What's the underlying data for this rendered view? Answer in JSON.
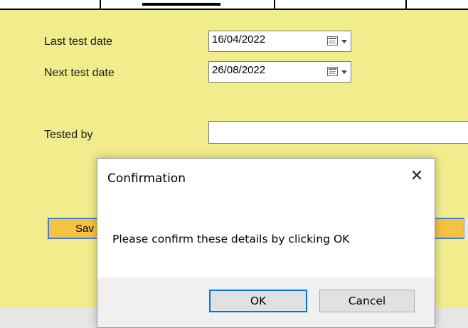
{
  "form": {
    "last_test_date_label": "Last test date",
    "last_test_date_value": "16/04/2022",
    "next_test_date_label": "Next test date",
    "next_test_date_value": "26/08/2022",
    "tested_by_label": "Tested by",
    "tested_by_value": "",
    "save_button_label": "Sav"
  },
  "dialog": {
    "title": "Confirmation",
    "close_glyph": "✕",
    "message": "Please confirm these details by clicking OK",
    "ok_label": "OK",
    "cancel_label": "Cancel"
  },
  "colors": {
    "form_background": "#f1ec8c",
    "button_yellow": "#f5c242",
    "focus_blue": "#0078d7"
  },
  "icons": {
    "date_picker": "calendar-icon",
    "dropdown": "chevron-down-icon",
    "close": "close-icon"
  }
}
